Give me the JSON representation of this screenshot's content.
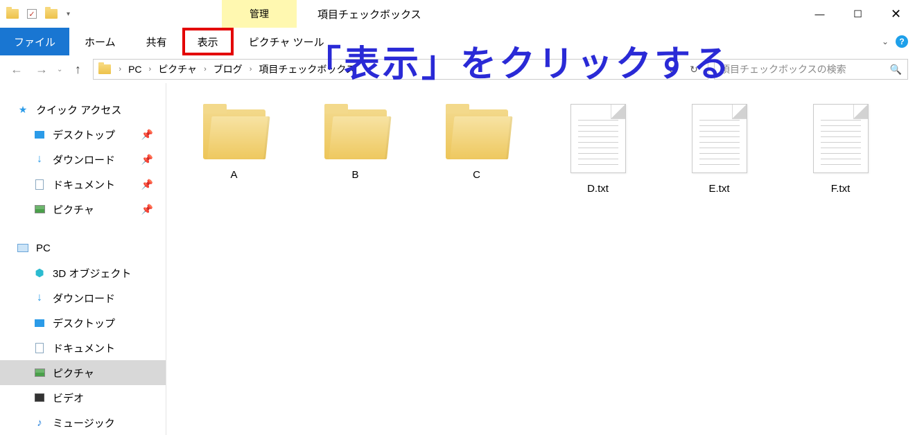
{
  "titlebar": {
    "context_tab": "管理",
    "window_title": "項目チェックボックス",
    "quick_access_dropdown": "▾"
  },
  "win_controls": {
    "min": "—",
    "max": "☐",
    "close": "✕"
  },
  "ribbon": {
    "file": "ファイル",
    "home": "ホーム",
    "share": "共有",
    "view": "表示",
    "picture_tools": "ピクチャ ツール",
    "chevron": "⌄",
    "help": "?"
  },
  "nav": {
    "back": "←",
    "forward": "→",
    "recent": "⌄",
    "up": "↑",
    "refresh": "↻",
    "dropdown": "⌄"
  },
  "breadcrumb": {
    "items": [
      "PC",
      "ピクチャ",
      "ブログ",
      "項目チェックボックス"
    ],
    "sep": "›"
  },
  "search": {
    "placeholder": "項目チェックボックスの検索",
    "icon": "🔍"
  },
  "sidebar": {
    "quick_access": "クイック アクセス",
    "desktop": "デスクトップ",
    "downloads": "ダウンロード",
    "documents": "ドキュメント",
    "pictures": "ピクチャ",
    "pc": "PC",
    "objects3d": "3D オブジェクト",
    "downloads2": "ダウンロード",
    "desktop2": "デスクトップ",
    "documents2": "ドキュメント",
    "pictures2": "ピクチャ",
    "videos": "ビデオ",
    "music": "ミュージック",
    "pin": "📌"
  },
  "items": [
    {
      "name": "A",
      "type": "folder"
    },
    {
      "name": "B",
      "type": "folder"
    },
    {
      "name": "C",
      "type": "folder"
    },
    {
      "name": "D.txt",
      "type": "file"
    },
    {
      "name": "E.txt",
      "type": "file"
    },
    {
      "name": "F.txt",
      "type": "file"
    }
  ],
  "annotation": "「表示」をクリックする"
}
